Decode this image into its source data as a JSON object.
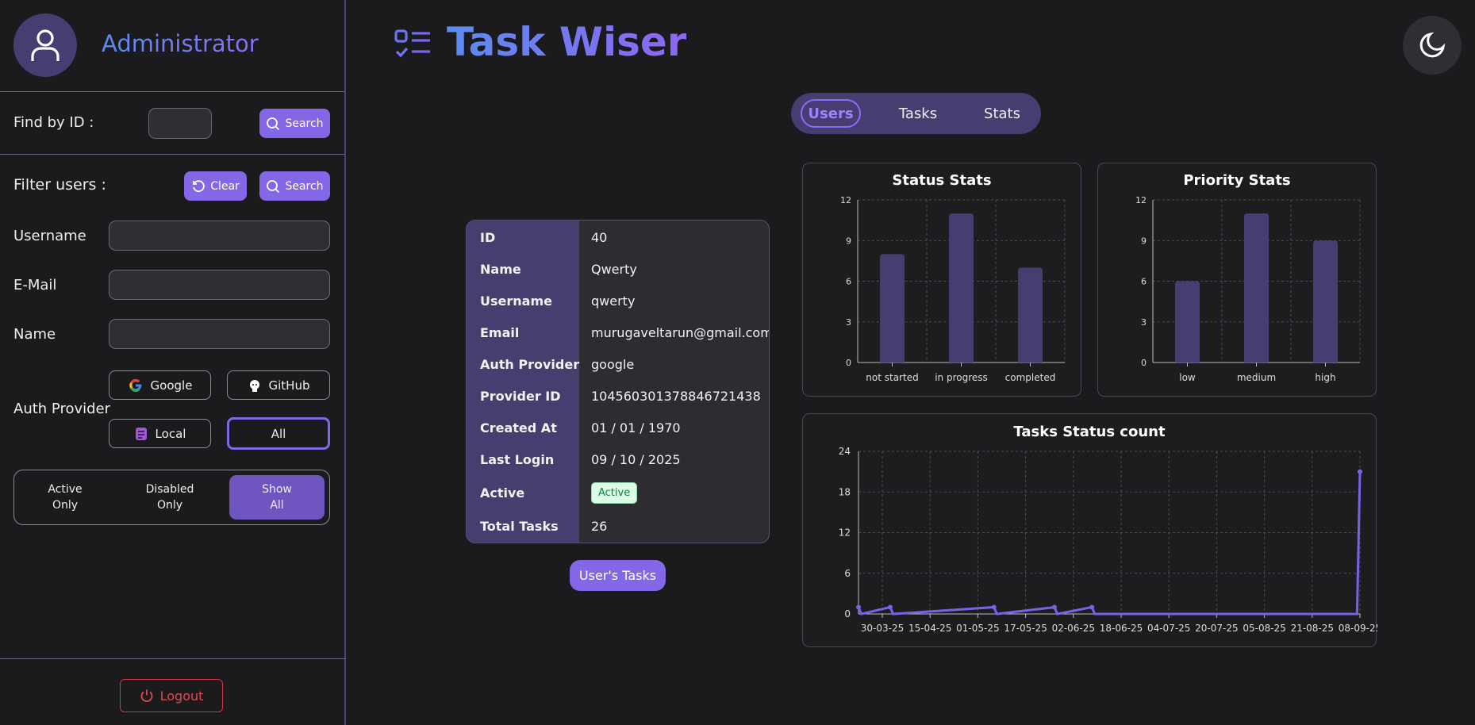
{
  "sidebar": {
    "user_role": "Administrator",
    "find_by_id": {
      "label": "Find by ID :",
      "value": "",
      "search_label": "Search"
    },
    "filter": {
      "label": "Filter users :",
      "clear_label": "Clear",
      "search_label": "Search"
    },
    "fields": {
      "username_label": "Username",
      "email_label": "E-Mail",
      "name_label": "Name",
      "auth_provider_label": "Auth Provider"
    },
    "providers": {
      "google": "Google",
      "github": "GitHub",
      "local": "Local",
      "all": "All",
      "selected": "All"
    },
    "status_filter": [
      {
        "line1": "Active",
        "line2": "Only"
      },
      {
        "line1": "Disabled",
        "line2": "Only"
      },
      {
        "line1": "Show",
        "line2": "All"
      }
    ],
    "status_selected": "Show All",
    "logout_label": "Logout"
  },
  "header": {
    "app_title": "Task Wiser"
  },
  "tabs": [
    {
      "label": "Users"
    },
    {
      "label": "Tasks"
    },
    {
      "label": "Stats"
    }
  ],
  "tab_active": "Users",
  "user": {
    "rows": [
      {
        "key": "ID",
        "value": "40"
      },
      {
        "key": "Name",
        "value": "Qwerty"
      },
      {
        "key": "Username",
        "value": "qwerty"
      },
      {
        "key": "Email",
        "value": "murugaveltarun@gmail.com"
      },
      {
        "key": "Auth Provider",
        "value": "google"
      },
      {
        "key": "Provider ID",
        "value": "104560301378846721438"
      },
      {
        "key": "Created At",
        "value": "01 / 01 / 1970"
      },
      {
        "key": "Last Login",
        "value": "09 / 10 / 2025"
      },
      {
        "key": "Active",
        "value": "Active"
      },
      {
        "key": "Total Tasks",
        "value": "26"
      }
    ],
    "user_tasks_label": "User's Tasks"
  },
  "colors": {
    "accent": "#8467e6",
    "bar": "#483d70",
    "line": "#7b61e8",
    "active_badge_bg": "#dcfce7",
    "danger": "#e44850"
  },
  "chart_data": [
    {
      "type": "bar",
      "title": "Status Stats",
      "categories": [
        "not started",
        "in progress",
        "completed"
      ],
      "values": [
        8,
        11,
        7
      ],
      "ylim": [
        0,
        12
      ],
      "yticks": [
        "0",
        "3",
        "6",
        "9",
        "12"
      ],
      "grid": true
    },
    {
      "type": "bar",
      "title": "Priority Stats",
      "categories": [
        "low",
        "medium",
        "high"
      ],
      "values": [
        6,
        11,
        9
      ],
      "ylim": [
        0,
        12
      ],
      "yticks": [
        "0",
        "3",
        "6",
        "9",
        "12"
      ],
      "grid": true
    },
    {
      "type": "line",
      "title": "Tasks Status count",
      "xticks": [
        "30-03-25",
        "15-04-25",
        "01-05-25",
        "17-05-25",
        "02-06-25",
        "18-06-25",
        "04-07-25",
        "20-07-25",
        "05-08-25",
        "21-08-25",
        "08-09-25"
      ],
      "yticks": [
        "0",
        "6",
        "12",
        "18",
        "24"
      ],
      "ylim": [
        0,
        24
      ],
      "xlim": [
        "2025-03-20",
        "2025-09-10"
      ],
      "points": [
        {
          "x": "2025-03-20",
          "y": 1
        },
        {
          "x": "2025-03-21",
          "y": 0
        },
        {
          "x": "2025-03-31",
          "y": 1
        },
        {
          "x": "2025-04-01",
          "y": 0
        },
        {
          "x": "2025-05-06",
          "y": 1
        },
        {
          "x": "2025-05-07",
          "y": 0
        },
        {
          "x": "2025-05-27",
          "y": 1
        },
        {
          "x": "2025-05-28",
          "y": 0
        },
        {
          "x": "2025-06-09",
          "y": 1
        },
        {
          "x": "2025-06-10",
          "y": 0
        },
        {
          "x": "2025-09-09",
          "y": 0
        },
        {
          "x": "2025-09-10",
          "y": 21
        }
      ],
      "grid": true
    }
  ]
}
